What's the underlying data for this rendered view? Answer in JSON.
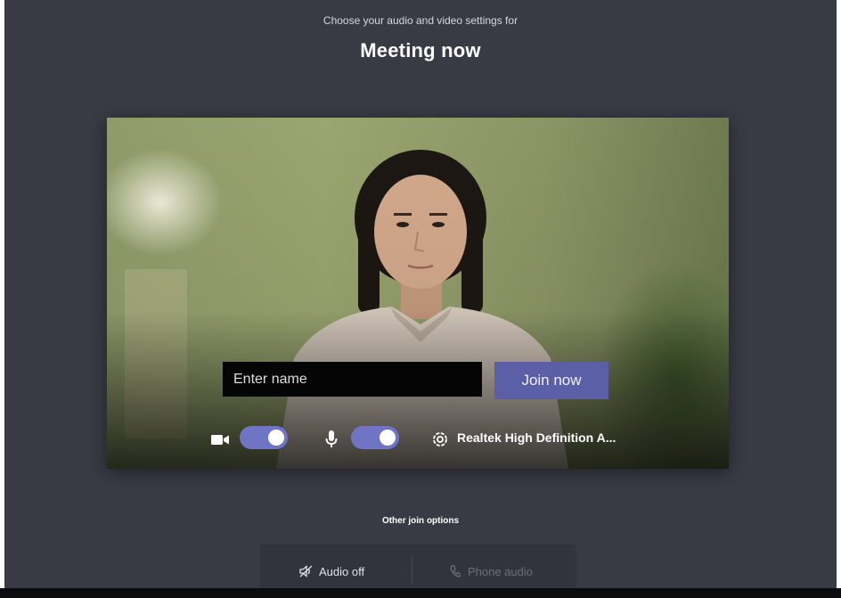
{
  "header": {
    "subtitle": "Choose your audio and video settings for",
    "title": "Meeting now"
  },
  "join": {
    "name_placeholder": "Enter name",
    "join_label": "Join now"
  },
  "devices": {
    "camera_on": true,
    "mic_on": true,
    "audio_device": "Realtek High Definition A..."
  },
  "other_options": {
    "heading": "Other join options",
    "audio_off_label": "Audio off",
    "phone_audio_label": "Phone audio"
  },
  "colors": {
    "background": "#3a3a45",
    "accent": "#5b5fa6",
    "toggle_on": "#6f74c4"
  }
}
